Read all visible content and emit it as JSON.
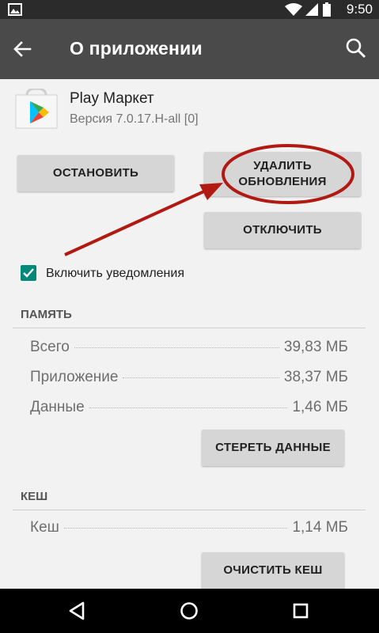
{
  "status_bar": {
    "time": "9:50",
    "icons": [
      "image-icon",
      "wifi-icon",
      "signal-icon",
      "battery-icon"
    ]
  },
  "app_bar": {
    "title": "О приложении",
    "icons": [
      "back-arrow-icon",
      "search-icon"
    ]
  },
  "app": {
    "name": "Play Маркет",
    "version": "Версия 7.0.17.H-all [0]",
    "icon": "play-store-icon"
  },
  "buttons": {
    "stop": "ОСТАНОВИТЬ",
    "uninstall_updates_line1": "УДАЛИТЬ",
    "uninstall_updates_line2": "ОБНОВЛЕНИЯ",
    "disable": "ОТКЛЮЧИТЬ",
    "clear_data": "СТЕРЕТЬ ДАННЫЕ",
    "clear_cache": "ОЧИСТИТЬ КЕШ"
  },
  "notifications": {
    "label": "Включить уведомления",
    "checked": true
  },
  "memory": {
    "header": "ПАМЯТЬ",
    "rows": [
      {
        "label": "Всего",
        "value": "39,83 МБ"
      },
      {
        "label": "Приложение",
        "value": "38,37 МБ"
      },
      {
        "label": "Данные",
        "value": "1,46 МБ"
      }
    ]
  },
  "cache": {
    "header": "КЕШ",
    "rows": [
      {
        "label": "Кеш",
        "value": "1,14 МБ"
      }
    ]
  },
  "annotation": {
    "color": "#b11a12"
  },
  "colors": {
    "accent": "#00897b",
    "app_bar": "#4a4a4a",
    "status_bar": "#2b2b2b"
  },
  "nav_bar": {
    "icons": [
      "back-triangle-icon",
      "home-circle-icon",
      "recents-square-icon"
    ]
  }
}
